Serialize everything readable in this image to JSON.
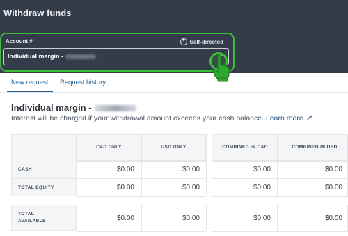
{
  "header": {
    "title": "Withdraw funds",
    "account_label": "Account #",
    "self_directed": "Self-directed",
    "selected_account": "Individual margin -"
  },
  "tabs": [
    {
      "label": "New request",
      "active": true
    },
    {
      "label": "Request history",
      "active": false
    }
  ],
  "section": {
    "title": "Individual margin -",
    "info_text": "Interest will be charged if your withdrawal amount exceeds your cash balance.",
    "learn_more": "Learn more"
  },
  "table": {
    "columns": [
      "CAD ONLY",
      "USD ONLY",
      "COMBINED IN CAD",
      "COMBINED IN USD"
    ],
    "rows": [
      {
        "label": "CASH",
        "values": [
          "$0.00",
          "$0.00",
          "$0.00",
          "$0.00"
        ]
      },
      {
        "label": "TOTAL EQUITY",
        "values": [
          "$0.00",
          "$0.00",
          "$0.00",
          "$0.00"
        ]
      },
      {
        "label": "TOTAL AVAILABLE",
        "values": [
          "$0.00",
          "$0.00",
          "$0.00",
          "$0.00"
        ]
      }
    ]
  },
  "colors": {
    "header_bg": "#343c49",
    "highlight": "#3bbf3b",
    "link": "#2a5b86",
    "arrow": "#5a3b96"
  },
  "icons": {
    "help": "question-circle-icon",
    "dropdown": "chevron-down-icon",
    "external": "arrow-up-right-icon",
    "cursor": "hand-pointer-icon"
  }
}
